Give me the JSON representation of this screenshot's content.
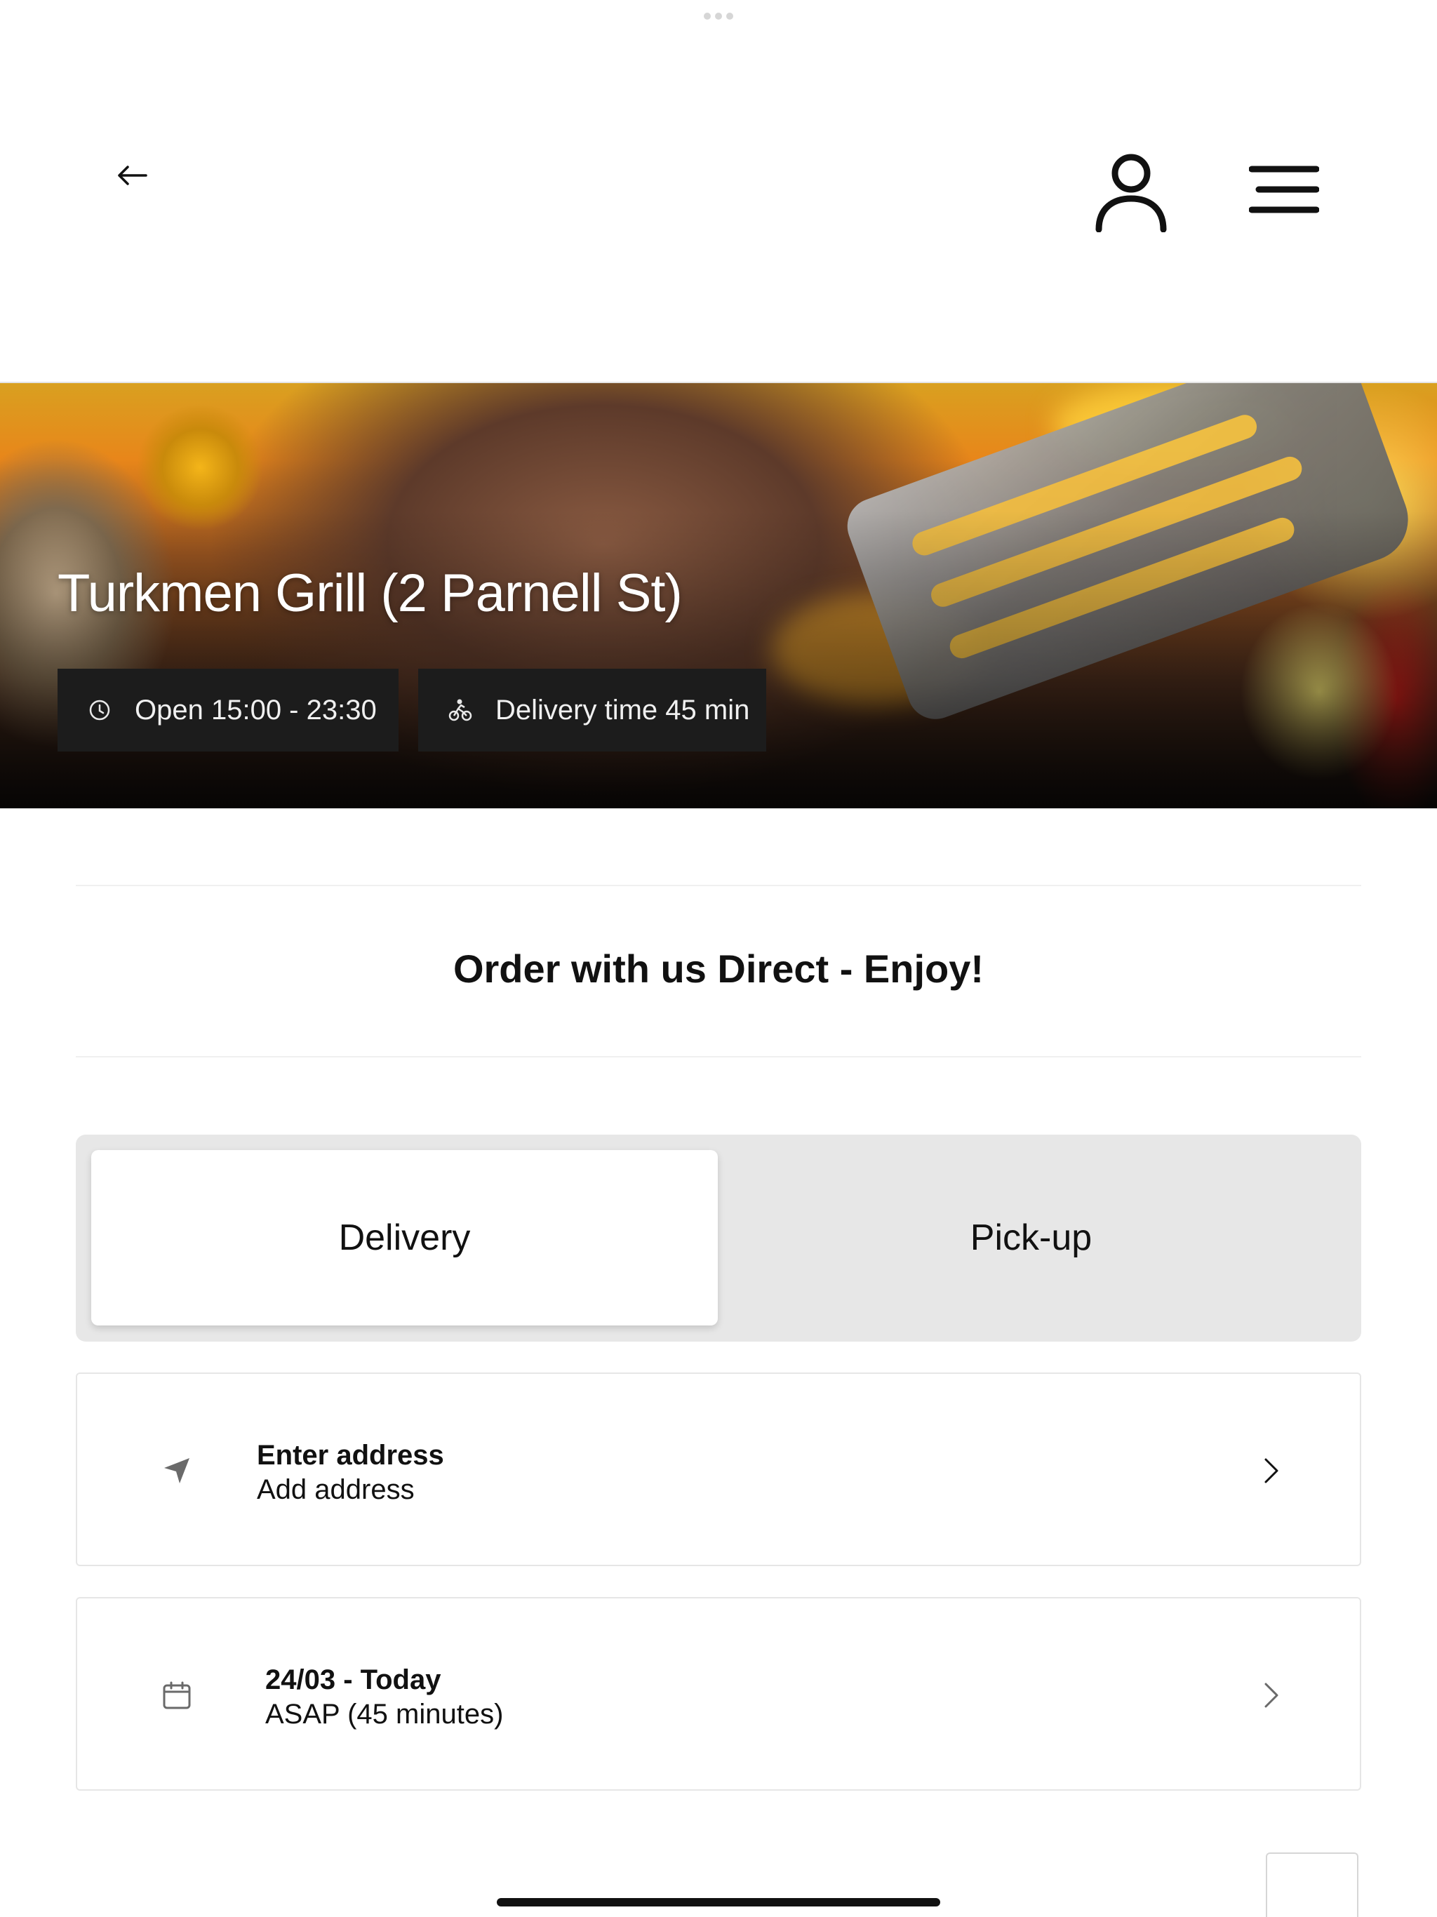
{
  "header": {
    "back_icon": "arrow-left-icon",
    "profile_icon": "user-icon",
    "menu_icon": "hamburger-menu-icon"
  },
  "hero": {
    "title": "Turkmen Grill (2 Parnell St)",
    "open_hours": "Open 15:00 - 23:30",
    "open_icon": "clock-icon",
    "delivery_time": "Delivery time 45 min",
    "delivery_icon": "bicycle-courier-icon"
  },
  "slogan": "Order with us Direct - Enjoy!",
  "order_type": {
    "options": [
      "Delivery",
      "Pick-up"
    ],
    "selected": "Delivery"
  },
  "address": {
    "title": "Enter address",
    "subtitle": "Add address",
    "icon": "location-arrow-icon"
  },
  "schedule": {
    "title": "24/03 - Today",
    "subtitle": "ASAP (45 minutes)",
    "icon": "calendar-icon"
  },
  "colors": {
    "chip_background": "#1c1c1c",
    "segment_background": "#e7e7e7",
    "selected_segment": "#ffffff",
    "text": "#111111"
  }
}
